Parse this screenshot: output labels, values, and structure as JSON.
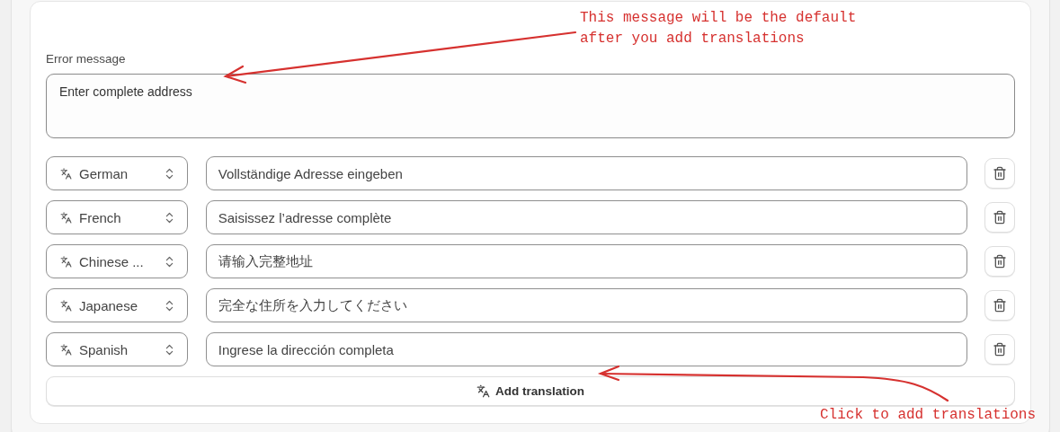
{
  "error_message": {
    "label": "Error message",
    "value": "Enter complete address"
  },
  "translations": [
    {
      "language": "German",
      "message": "Vollständige Adresse eingeben"
    },
    {
      "language": "French",
      "message": "Saisissez l’adresse complète"
    },
    {
      "language": "Chinese ...",
      "message": "请输入完整地址"
    },
    {
      "language": "Japanese",
      "message": "完全な住所を入力してください"
    },
    {
      "language": "Spanish",
      "message": "Ingrese la dirección completa"
    }
  ],
  "add_button": {
    "label": "Add translation"
  },
  "annotations": [
    {
      "kind": "top",
      "text": "This message will be the default\nafter you add translations"
    },
    {
      "kind": "bottom",
      "text": "Click to add translations"
    }
  ]
}
